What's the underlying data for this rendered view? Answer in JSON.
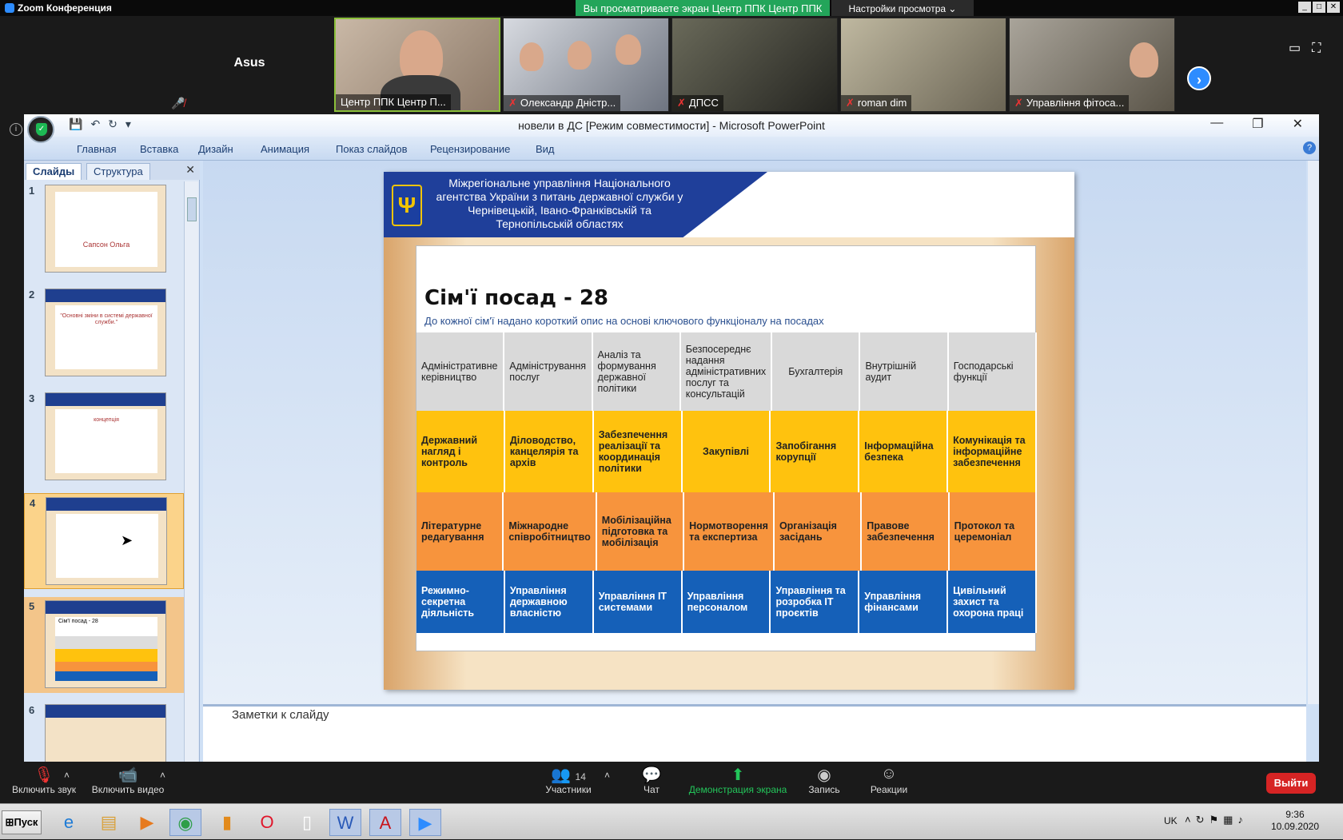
{
  "zoom": {
    "app_title": "Zoom Конференция",
    "share_banner": "Вы просматриваете экран Центр ППК Центр ППК",
    "view_settings": "Настройки просмотра",
    "participants": [
      {
        "name": "Asus"
      },
      {
        "name": "Центр ППК Центр П..."
      },
      {
        "name": "Олександр Дністр..."
      },
      {
        "name": "ДПСС"
      },
      {
        "name": "roman dim"
      },
      {
        "name": "Управління фітоса..."
      }
    ],
    "toolbar": {
      "audio": "Включить звук",
      "video": "Включить видео",
      "participants": "Участники",
      "participants_count": "14",
      "chat": "Чат",
      "share": "Демонстрация экрана",
      "record": "Запись",
      "reactions": "Реакции",
      "leave": "Выйти"
    }
  },
  "ppt": {
    "window_title": "новели в ДС [Режим совместимости] - Microsoft PowerPoint",
    "tabs": [
      "Главная",
      "Вставка",
      "Дизайн",
      "Анимация",
      "Показ слайдов",
      "Рецензирование",
      "Вид"
    ],
    "panel_tabs": [
      "Слайды",
      "Структура"
    ],
    "thumbnails": [
      {
        "num": "1",
        "caption": "Сапсон Ольга"
      },
      {
        "num": "2",
        "caption": "\"Основні зміни в системі державної служби.\""
      },
      {
        "num": "3",
        "caption": "концепція"
      },
      {
        "num": "4",
        "caption": ""
      },
      {
        "num": "5",
        "caption": "Сім'ї посад - 28"
      },
      {
        "num": "6",
        "caption": ""
      }
    ],
    "notes_label": "Заметки к слайду"
  },
  "slide": {
    "org_name": "Міжрегіональне управління Національного агентства України з питань державної служби у Чернівецькій, Івано-Франківській та Тернопільській областях",
    "title": "Сім'ї посад - 28",
    "subtitle": "До кожної сім'ї надано короткий опис на основі ключового функціоналу на посадах",
    "rows": [
      [
        "Адміністративне керівництво",
        "Адміністрування послуг",
        "Аналіз та формування державної політики",
        "Безпосереднє надання адміністративних послуг та консультацій",
        "Бухгалтерія",
        "Внутрішній аудит",
        "Господарські функції"
      ],
      [
        "Державний нагляд і контроль",
        "Діловодство, канцелярія та архів",
        "Забезпечення реалізації та координація політики",
        "Закупівлі",
        "Запобігання корупції",
        "Інформаційна безпека",
        "Комунікація та інформаційне забезпечення"
      ],
      [
        "Літературне редагування",
        "Міжнародне співробітництво",
        "Мобілізаційна підготовка та мобілізація",
        "Нормотворення та експертиза",
        "Організація засідань",
        "Правове забезпечення",
        "Протокол та церемоніал"
      ],
      [
        "Режимно-секретна діяльність",
        "Управління державною власністю",
        "Управління ІТ системами",
        "Управління персоналом",
        "Управління та розробка ІТ проєктів",
        "Управління фінансами",
        "Цивільний захист та охорона праці"
      ]
    ]
  },
  "taskbar": {
    "start": "Пуск",
    "lang": "UK",
    "time": "9:36",
    "date": "10.09.2020"
  }
}
